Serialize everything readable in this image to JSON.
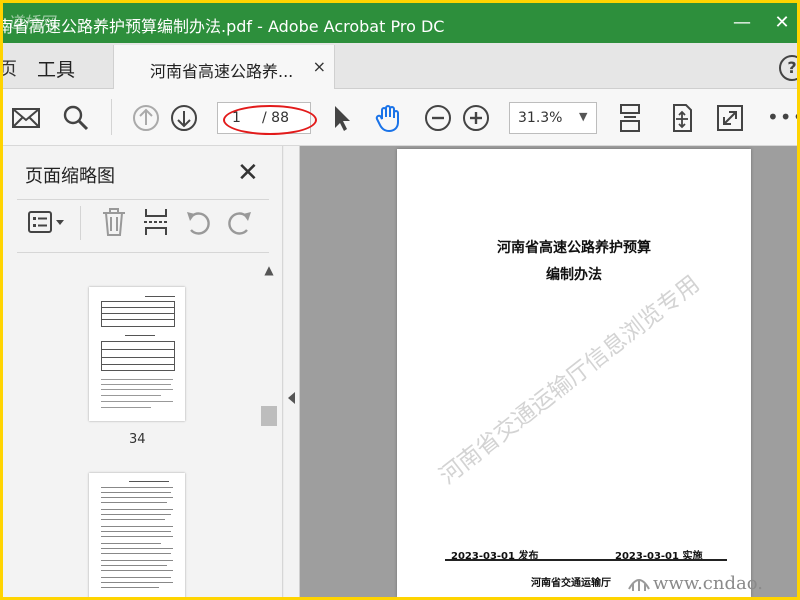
{
  "window": {
    "title": "南省高速公路养护预算编制办法.pdf - Adobe Acrobat Pro DC",
    "logo_text": "道桥网",
    "minimize_glyph": "—",
    "close_glyph": "✕"
  },
  "tabs": {
    "home_partial": "页",
    "tools": "工具",
    "doc_tab": "河南省高速公路养...",
    "doc_tab_close": "×",
    "help": "?"
  },
  "toolbar": {
    "icons": [
      "mail-icon",
      "search-icon",
      "arrow-up-icon",
      "arrow-down-icon",
      "pointer-icon",
      "hand-icon",
      "zoom-out-icon",
      "zoom-in-icon",
      "fit-page-icon",
      "rotate-fit-icon",
      "fullscreen-icon"
    ],
    "page_current": "1",
    "page_total": "/ 88",
    "zoom": "31.3%",
    "zoom_caret": "▼",
    "more": "•••"
  },
  "sidebar": {
    "title": "页面缩略图",
    "close": "✕",
    "thumbnail_1_page": "34",
    "scroll_up": "▲"
  },
  "document": {
    "title_line1": "河南省高速公路养护预算",
    "title_line2": "编制办法",
    "publish_date": "2023-03-01 发布",
    "implement_date": "2023-03-01  实施",
    "issuer": "河南省交通运输厅",
    "watermark": "河南省交通运输厅信息浏览专用",
    "site_watermark": "www.cndao."
  },
  "colors": {
    "titlebar": "#2d8f3c",
    "border": "#ffd400",
    "annotation": "#e21a1a"
  }
}
